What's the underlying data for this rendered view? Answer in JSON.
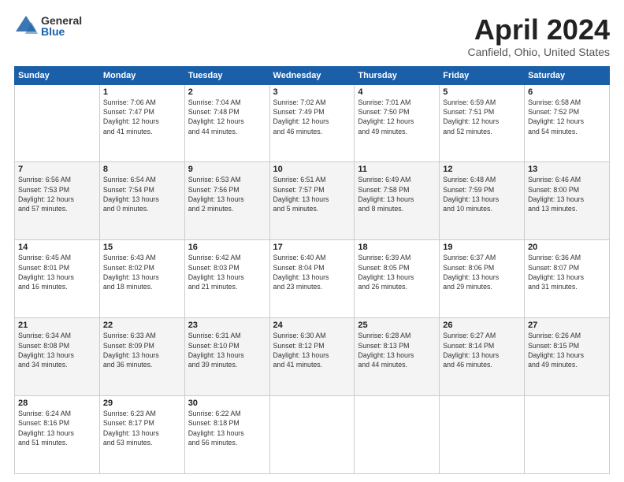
{
  "header": {
    "logo_general": "General",
    "logo_blue": "Blue",
    "month_title": "April 2024",
    "location": "Canfield, Ohio, United States"
  },
  "days_of_week": [
    "Sunday",
    "Monday",
    "Tuesday",
    "Wednesday",
    "Thursday",
    "Friday",
    "Saturday"
  ],
  "weeks": [
    [
      {
        "day": "",
        "info": ""
      },
      {
        "day": "1",
        "info": "Sunrise: 7:06 AM\nSunset: 7:47 PM\nDaylight: 12 hours\nand 41 minutes."
      },
      {
        "day": "2",
        "info": "Sunrise: 7:04 AM\nSunset: 7:48 PM\nDaylight: 12 hours\nand 44 minutes."
      },
      {
        "day": "3",
        "info": "Sunrise: 7:02 AM\nSunset: 7:49 PM\nDaylight: 12 hours\nand 46 minutes."
      },
      {
        "day": "4",
        "info": "Sunrise: 7:01 AM\nSunset: 7:50 PM\nDaylight: 12 hours\nand 49 minutes."
      },
      {
        "day": "5",
        "info": "Sunrise: 6:59 AM\nSunset: 7:51 PM\nDaylight: 12 hours\nand 52 minutes."
      },
      {
        "day": "6",
        "info": "Sunrise: 6:58 AM\nSunset: 7:52 PM\nDaylight: 12 hours\nand 54 minutes."
      }
    ],
    [
      {
        "day": "7",
        "info": "Sunrise: 6:56 AM\nSunset: 7:53 PM\nDaylight: 12 hours\nand 57 minutes."
      },
      {
        "day": "8",
        "info": "Sunrise: 6:54 AM\nSunset: 7:54 PM\nDaylight: 13 hours\nand 0 minutes."
      },
      {
        "day": "9",
        "info": "Sunrise: 6:53 AM\nSunset: 7:56 PM\nDaylight: 13 hours\nand 2 minutes."
      },
      {
        "day": "10",
        "info": "Sunrise: 6:51 AM\nSunset: 7:57 PM\nDaylight: 13 hours\nand 5 minutes."
      },
      {
        "day": "11",
        "info": "Sunrise: 6:49 AM\nSunset: 7:58 PM\nDaylight: 13 hours\nand 8 minutes."
      },
      {
        "day": "12",
        "info": "Sunrise: 6:48 AM\nSunset: 7:59 PM\nDaylight: 13 hours\nand 10 minutes."
      },
      {
        "day": "13",
        "info": "Sunrise: 6:46 AM\nSunset: 8:00 PM\nDaylight: 13 hours\nand 13 minutes."
      }
    ],
    [
      {
        "day": "14",
        "info": "Sunrise: 6:45 AM\nSunset: 8:01 PM\nDaylight: 13 hours\nand 16 minutes."
      },
      {
        "day": "15",
        "info": "Sunrise: 6:43 AM\nSunset: 8:02 PM\nDaylight: 13 hours\nand 18 minutes."
      },
      {
        "day": "16",
        "info": "Sunrise: 6:42 AM\nSunset: 8:03 PM\nDaylight: 13 hours\nand 21 minutes."
      },
      {
        "day": "17",
        "info": "Sunrise: 6:40 AM\nSunset: 8:04 PM\nDaylight: 13 hours\nand 23 minutes."
      },
      {
        "day": "18",
        "info": "Sunrise: 6:39 AM\nSunset: 8:05 PM\nDaylight: 13 hours\nand 26 minutes."
      },
      {
        "day": "19",
        "info": "Sunrise: 6:37 AM\nSunset: 8:06 PM\nDaylight: 13 hours\nand 29 minutes."
      },
      {
        "day": "20",
        "info": "Sunrise: 6:36 AM\nSunset: 8:07 PM\nDaylight: 13 hours\nand 31 minutes."
      }
    ],
    [
      {
        "day": "21",
        "info": "Sunrise: 6:34 AM\nSunset: 8:08 PM\nDaylight: 13 hours\nand 34 minutes."
      },
      {
        "day": "22",
        "info": "Sunrise: 6:33 AM\nSunset: 8:09 PM\nDaylight: 13 hours\nand 36 minutes."
      },
      {
        "day": "23",
        "info": "Sunrise: 6:31 AM\nSunset: 8:10 PM\nDaylight: 13 hours\nand 39 minutes."
      },
      {
        "day": "24",
        "info": "Sunrise: 6:30 AM\nSunset: 8:12 PM\nDaylight: 13 hours\nand 41 minutes."
      },
      {
        "day": "25",
        "info": "Sunrise: 6:28 AM\nSunset: 8:13 PM\nDaylight: 13 hours\nand 44 minutes."
      },
      {
        "day": "26",
        "info": "Sunrise: 6:27 AM\nSunset: 8:14 PM\nDaylight: 13 hours\nand 46 minutes."
      },
      {
        "day": "27",
        "info": "Sunrise: 6:26 AM\nSunset: 8:15 PM\nDaylight: 13 hours\nand 49 minutes."
      }
    ],
    [
      {
        "day": "28",
        "info": "Sunrise: 6:24 AM\nSunset: 8:16 PM\nDaylight: 13 hours\nand 51 minutes."
      },
      {
        "day": "29",
        "info": "Sunrise: 6:23 AM\nSunset: 8:17 PM\nDaylight: 13 hours\nand 53 minutes."
      },
      {
        "day": "30",
        "info": "Sunrise: 6:22 AM\nSunset: 8:18 PM\nDaylight: 13 hours\nand 56 minutes."
      },
      {
        "day": "",
        "info": ""
      },
      {
        "day": "",
        "info": ""
      },
      {
        "day": "",
        "info": ""
      },
      {
        "day": "",
        "info": ""
      }
    ]
  ]
}
